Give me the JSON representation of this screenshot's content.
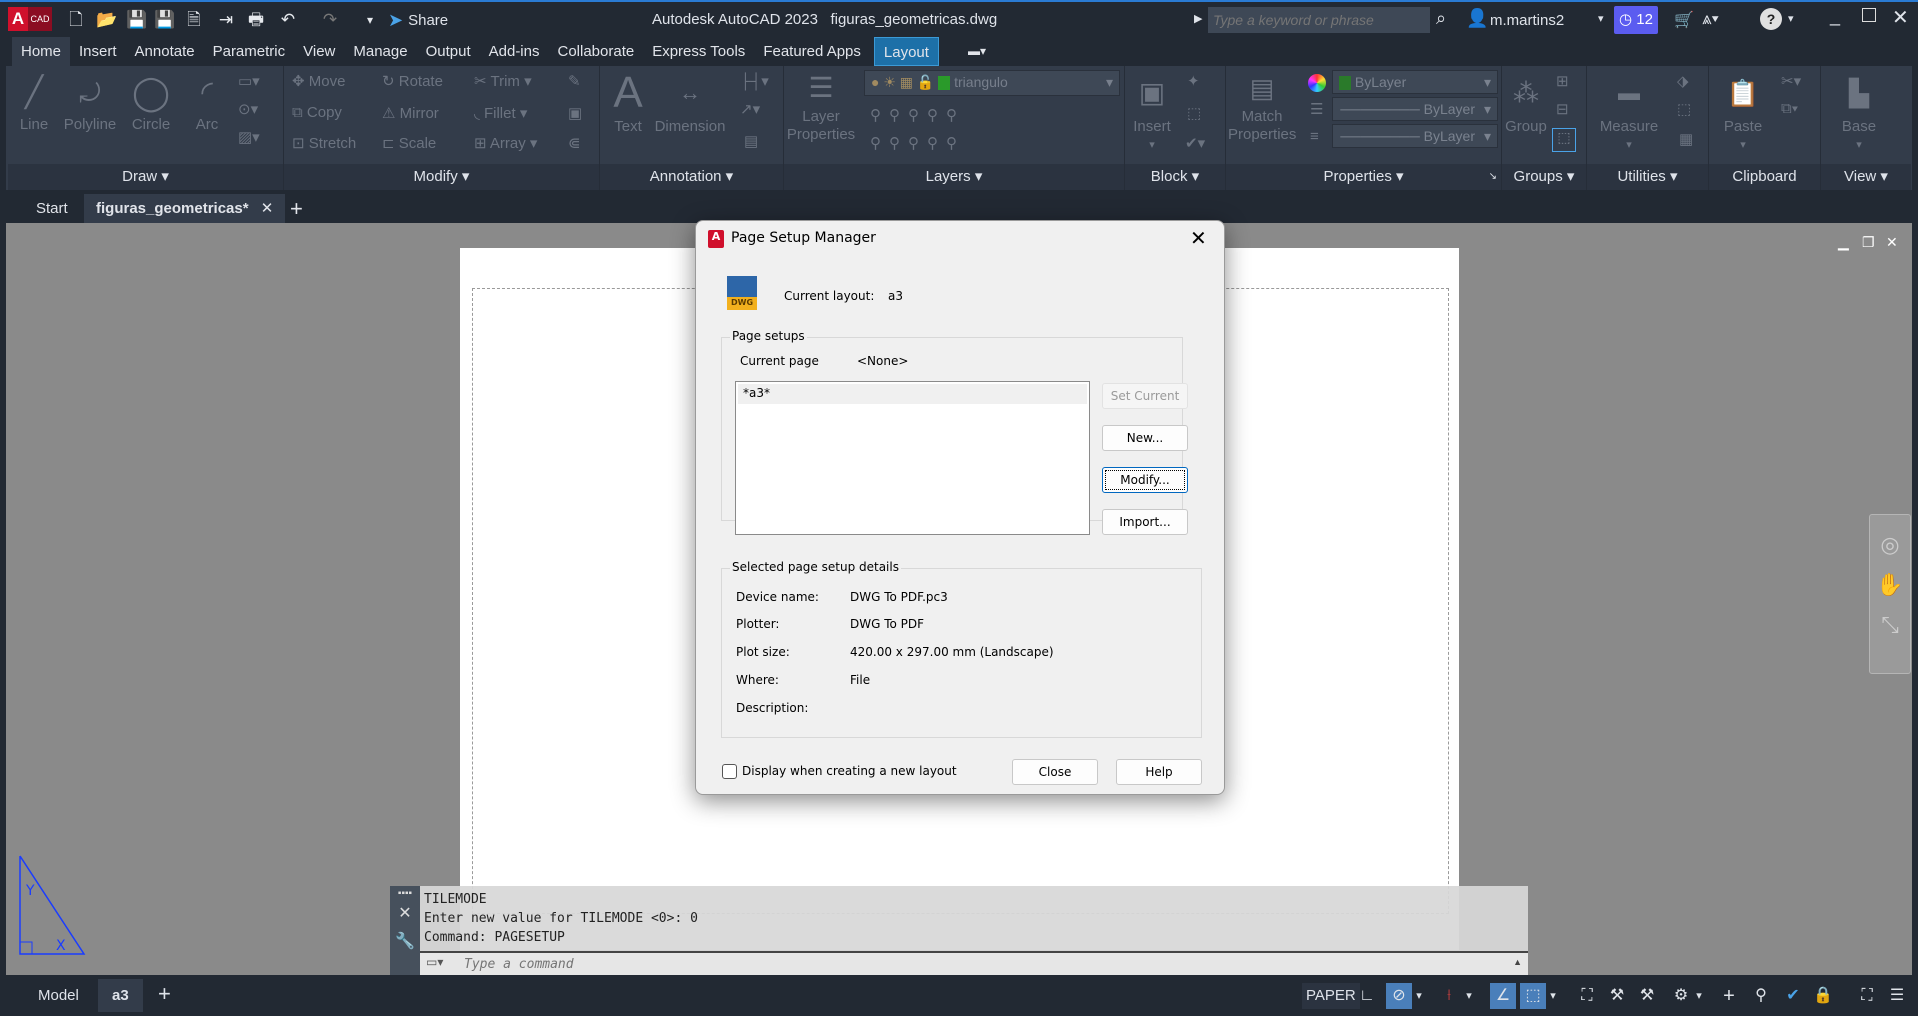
{
  "titlebar": {
    "logo": "A",
    "logo_sub": "CAD",
    "share": "Share",
    "title": "Autodesk AutoCAD 2023   figuras_geometricas.dwg",
    "search_placeholder": "Type a keyword or phrase",
    "user": "m.martins2",
    "notifications": "12"
  },
  "ribbon_tabs": [
    "Home",
    "Insert",
    "Annotate",
    "Parametric",
    "View",
    "Manage",
    "Output",
    "Add-ins",
    "Collaborate",
    "Express Tools",
    "Featured Apps",
    "Layout"
  ],
  "panels": {
    "draw": {
      "title": "Draw",
      "line": "Line",
      "polyline": "Polyline",
      "circle": "Circle",
      "arc": "Arc"
    },
    "modify": {
      "title": "Modify",
      "move": "Move",
      "rotate": "Rotate",
      "trim": "Trim",
      "copy": "Copy",
      "mirror": "Mirror",
      "fillet": "Fillet",
      "stretch": "Stretch",
      "scale": "Scale",
      "array": "Array"
    },
    "annotation": {
      "title": "Annotation",
      "text": "Text",
      "dimension": "Dimension"
    },
    "layers": {
      "title": "Layers",
      "layer_properties_1": "Layer",
      "layer_properties_2": "Properties",
      "current_layer": "triangulo"
    },
    "block": {
      "title": "Block",
      "insert": "Insert"
    },
    "properties": {
      "title": "Properties",
      "match_1": "Match",
      "match_2": "Properties",
      "color": "ByLayer",
      "linetype": "ByLayer",
      "lineweight": "ByLayer"
    },
    "groups": {
      "title": "Groups",
      "group": "Group"
    },
    "utilities": {
      "title": "Utilities",
      "measure": "Measure"
    },
    "clipboard": {
      "title": "Clipboard",
      "paste": "Paste"
    },
    "view": {
      "title": "View",
      "base": "Base"
    }
  },
  "doc_tabs": {
    "start": "Start",
    "file": "figuras_geometricas*"
  },
  "dialog": {
    "title": "Page Setup Manager",
    "icon_text": "DWG",
    "current_layout_label": "Current layout:",
    "current_layout": "a3",
    "page_setups_label": "Page setups",
    "current_page_label": "Current page",
    "current_page": "<None>",
    "list_items": [
      "*a3*"
    ],
    "set_current": "Set Current",
    "new": "New...",
    "modify": "Modify...",
    "import": "Import...",
    "details_label": "Selected page setup details",
    "details": [
      {
        "label": "Device name:",
        "value": "DWG To PDF.pc3"
      },
      {
        "label": "Plotter:",
        "value": "DWG To PDF"
      },
      {
        "label": "Plot size:",
        "value": "420.00 x 297.00 mm (Landscape)"
      },
      {
        "label": "Where:",
        "value": "File"
      },
      {
        "label": "Description:",
        "value": ""
      }
    ],
    "display_checkbox": "Display when creating a new layout",
    "display_checked": false,
    "close": "Close",
    "help": "Help"
  },
  "command": {
    "lines": [
      "TILEMODE",
      "Enter new value for TILEMODE <0>: 0",
      "Command: PAGESETUP"
    ],
    "placeholder": "Type a command"
  },
  "layout_tabs": {
    "model": "Model",
    "a3": "a3"
  },
  "status": {
    "paper": "PAPER"
  }
}
